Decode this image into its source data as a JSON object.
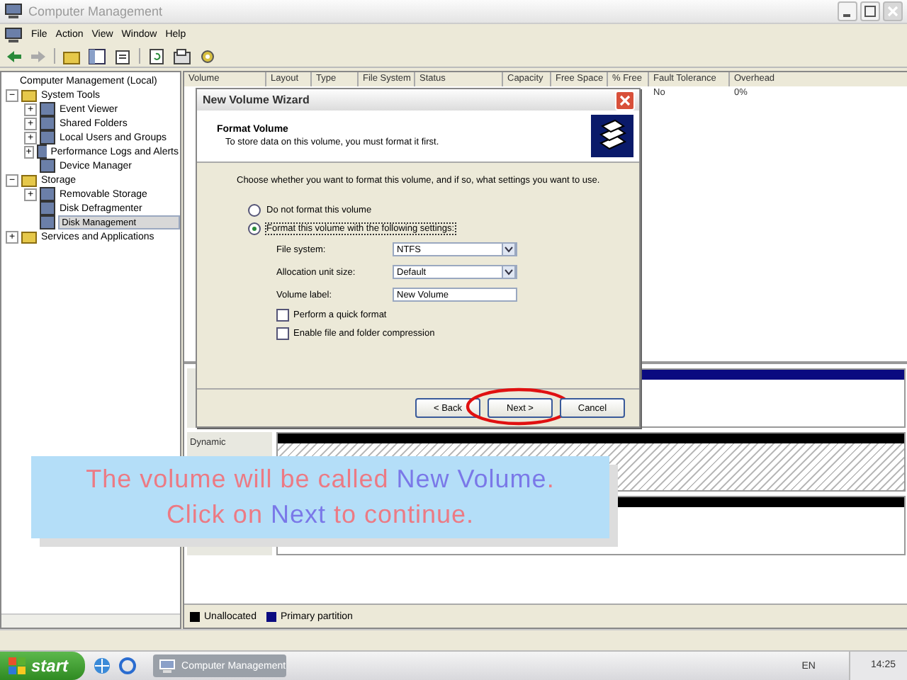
{
  "window": {
    "title": "Computer Management"
  },
  "menu": [
    "File",
    "Action",
    "View",
    "Window",
    "Help"
  ],
  "tree": [
    {
      "label": "Computer Management (Local)",
      "selected": false,
      "children": [
        {
          "label": "System Tools",
          "toggle": "−",
          "selected": false,
          "children": [
            {
              "label": "Event Viewer",
              "toggle": "+",
              "selected": false
            },
            {
              "label": "Shared Folders",
              "toggle": "+",
              "selected": false
            },
            {
              "label": "Local Users and Groups",
              "toggle": "+",
              "selected": false
            },
            {
              "label": "Performance Logs and Alerts",
              "toggle": "+",
              "selected": false
            },
            {
              "label": "Device Manager",
              "selected": false
            }
          ]
        },
        {
          "label": "Storage",
          "toggle": "−",
          "selected": false,
          "children": [
            {
              "label": "Removable Storage",
              "toggle": "+",
              "selected": false
            },
            {
              "label": "Disk Defragmenter",
              "selected": false
            },
            {
              "label": "Disk Management",
              "selected": true
            }
          ]
        },
        {
          "label": "Services and Applications",
          "toggle": "+",
          "selected": false
        }
      ]
    }
  ],
  "table": {
    "columns": [
      "Volume",
      "Layout",
      "Type",
      "File System",
      "Status",
      "Capacity",
      "Free Space",
      "% Free",
      "Fault Tolerance",
      "Overhead"
    ],
    "rows": [
      [
        "",
        "",
        "",
        "",
        "",
        "",
        "",
        "",
        "No",
        "0%"
      ]
    ]
  },
  "disks": [
    {
      "color": "#0a0a80",
      "hatched": false
    },
    {
      "label": "Dynamic",
      "color": "#000000",
      "hatched": true
    },
    {
      "color": "#000000",
      "hatched": false
    }
  ],
  "legend": [
    {
      "label": "Unallocated",
      "color": "#000000"
    },
    {
      "label": "Primary partition",
      "color": "#0a0a80"
    }
  ],
  "dialog": {
    "title": "New Volume Wizard",
    "heading": "Format Volume",
    "subheading": "To store data on this volume, you must format it first.",
    "intro": "Choose whether you want to format this volume, and if so, what settings you want to use.",
    "options": [
      {
        "label": "Do not format this volume",
        "selected": false
      },
      {
        "label": "Format this volume with the following settings:",
        "selected": true
      }
    ],
    "fields": [
      {
        "label": "File system:",
        "value": "NTFS",
        "kind": "select"
      },
      {
        "label": "Allocation unit size:",
        "value": "Default",
        "kind": "select"
      },
      {
        "label": "Volume label:",
        "value": "New Volume",
        "kind": "text"
      }
    ],
    "checkboxes": [
      {
        "label": "Perform a quick format",
        "checked": false
      },
      {
        "label": "Enable file and folder compression",
        "checked": false
      }
    ],
    "buttons": [
      {
        "label": "< Back",
        "highlighted": false
      },
      {
        "label": "Next >",
        "highlighted": true
      },
      {
        "label": "Cancel",
        "highlighted": false
      }
    ]
  },
  "caption": {
    "lines": [
      [
        {
          "text": "The volume will be called ",
          "emphasis": false
        },
        {
          "text": "New Volume",
          "emphasis": true
        },
        {
          "text": ".",
          "emphasis": false
        }
      ],
      [
        {
          "text": "Click on ",
          "emphasis": false
        },
        {
          "text": "Next",
          "emphasis": true
        },
        {
          "text": " to continue.",
          "emphasis": false
        }
      ]
    ]
  },
  "taskbar": {
    "start": "start",
    "tasks": [
      "Computer Management"
    ],
    "language": "EN",
    "clock": "14:25"
  }
}
